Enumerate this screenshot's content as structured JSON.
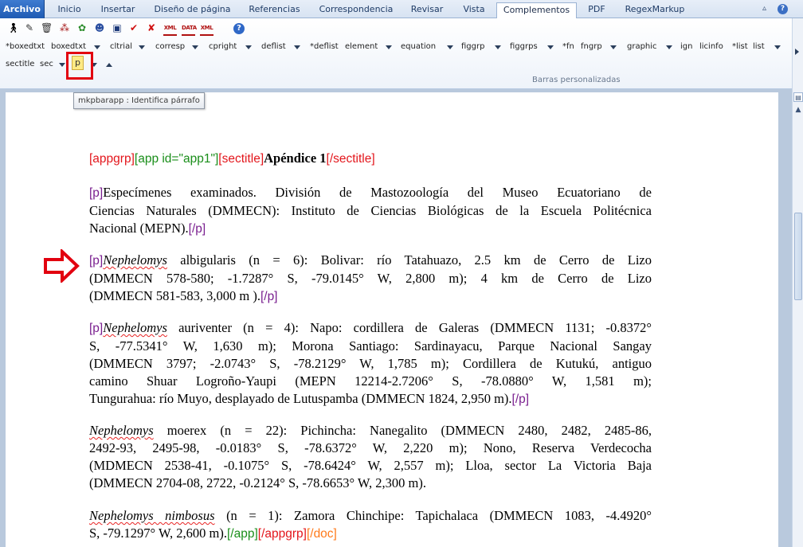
{
  "ribbon_tabs": [
    "Archivo",
    "Inicio",
    "Insertar",
    "Diseño de página",
    "Referencias",
    "Correspondencia",
    "Revisar",
    "Vista",
    "Complementos",
    "PDF",
    "RegexMarkup"
  ],
  "active_tab": "Complementos",
  "toolbar_row2": [
    "*boxedtxt",
    "boxedtxt",
    "cltrial",
    "corresp",
    "cpright",
    "deflist",
    "*deflist",
    "element",
    "equation",
    "figgrp",
    "figgrps",
    "*fn",
    "fngrp",
    "graphic",
    "ign",
    "licinfo",
    "*list",
    "list"
  ],
  "toolbar_row3": [
    "sectitle",
    "sec",
    "p"
  ],
  "toolbar_icons": [
    "person-icon",
    "pen-icon",
    "trash-icon",
    "group-icon",
    "colorwheel-icon",
    "robot-icon",
    "save-icon",
    "checkmark-icon",
    "close-x-icon",
    "xml-icon",
    "xml-data-icon",
    "xml-file-icon",
    "help-icon"
  ],
  "icon_small_labels": {
    "xml": "XML",
    "data": "DATA",
    "xmlfile": "XML"
  },
  "group_label": "Barras personalizadas",
  "tooltip": "mkpbarapp : Identifica párrafo",
  "window_controls": [
    "▵",
    "?"
  ],
  "colors": {
    "tag_red": "#e3161c",
    "tag_green": "#1a8e1a",
    "tag_purple": "#7a1f8f",
    "tag_orange": "#ff7a1a",
    "highlight_box": "#e2000f",
    "pointer_arrow": "#e2000f"
  },
  "doc": {
    "title": {
      "t1": "[appgrp]",
      "t2": "[app id=\"app1\"]",
      "t3": "[sectitle]",
      "t4": "Apéndice 1",
      "t5": "[/sectitle]"
    },
    "p1": {
      "open": "[p]",
      "l1": "Especímenes examinados. División de Mastozoología del Museo Ecuatoriano de",
      "l2": "Ciencias Naturales (DMMECN): Instituto de Ciencias Biológicas de la Escuela Politécnica",
      "l3": "Nacional (MEPN).",
      "close": "[/p]"
    },
    "p2": {
      "open": "[p]",
      "genus": "Nephelomys",
      "l1a": " albigularis (n = 6): Bolivar: río Tatahuazo, 2.5 km de Cerro de Lizo",
      "l2": "(DMMECN 578-580; -1.7287° S, -79.0145° W, 2,800 m); 4 km de Cerro de Lizo",
      "l3": "(DMMECN 581-583, 3,000 m ).",
      "close": "[/p]"
    },
    "p3": {
      "open": "[p]",
      "genus": "Nephelomys",
      "l1a": " auriventer (n = 4): Napo: cordillera de Galeras (DMMECN 1131; -0.8372°",
      "l2": "S, -77.5341° W, 1,630 m); Morona Santiago: Sardinayacu, Parque Nacional Sangay",
      "l3": "(DMMECN 3797; -2.0743° S, -78.2129° W, 1,785 m); Cordillera de Kutukú, antiguo",
      "l4": "camino Shuar Logroño-Yaupi (MEPN 12214-2.7206° S, -78.0880° W, 1,581 m);",
      "l5": "Tungurahua: río Muyo, desplayado de Lutuspamba (DMMECN 1824, 2,950 m).",
      "close": "[/p]"
    },
    "p4": {
      "genus": "Nephelomys",
      "l1a": " moerex (n = 22): Pichincha: Nanegalito (DMMECN 2480, 2482, 2485-86,",
      "l2": "2492-93, 2495-98, -0.0183° S, -78.6372° W, 2,220 m); Nono, Reserva Verdecocha",
      "l3": "(MDMECN 2538-41, -0.1075° S, -78.6424° W, 2,557 m); Lloa, sector La Victoria Baja",
      "l4": "(DMMECN 2704-08, 2722, -0.2124° S, -78.6653° W, 2,300 m)."
    },
    "p5": {
      "genus": "Nephelomys nimbosus",
      "l1a": " (n = 1): Zamora Chinchipe: Tapichalaca (DMMECN 1083, -4.4920°",
      "l2": "S, -79.1297° W, 2,600 m).",
      "c1": "[/app]",
      "c2": "[/appgrp]",
      "c3": "[/doc]"
    }
  }
}
